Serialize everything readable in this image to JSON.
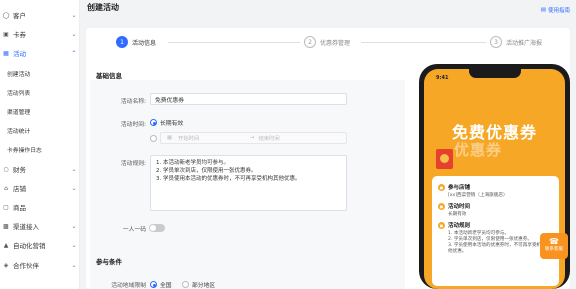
{
  "sidebar": {
    "items": [
      {
        "label": "客户",
        "icon": "user-icon"
      },
      {
        "label": "卡券",
        "icon": "ticket-icon"
      },
      {
        "label": "活动",
        "icon": "gift-icon"
      },
      {
        "label": "财务",
        "icon": "wallet-icon"
      },
      {
        "label": "店铺",
        "icon": "store-icon"
      },
      {
        "label": "商品",
        "icon": "box-icon"
      },
      {
        "label": "渠道接入",
        "icon": "plug-icon"
      },
      {
        "label": "自动化营销",
        "icon": "auto-icon"
      },
      {
        "label": "合作伙伴",
        "icon": "partner-icon"
      }
    ],
    "sub_items": [
      "创建活动",
      "活动列表",
      "渠道管理",
      "活动统计",
      "卡券操作日志"
    ]
  },
  "header": {
    "title": "创建活动",
    "help_label": "使用指南"
  },
  "steps": [
    {
      "num": "1",
      "label": "活动信息"
    },
    {
      "num": "2",
      "label": "优惠券管理"
    },
    {
      "num": "3",
      "label": "活动推广海报"
    }
  ],
  "form": {
    "section_basic": "基础信息",
    "name_label": "活动名称:",
    "name_value": "免费优惠券",
    "time_label": "活动时间:",
    "time_option_long": "长期有效",
    "start_placeholder": "开始时间",
    "end_placeholder": "结束时间",
    "rules_label": "活动规则:",
    "rules_lines": [
      "1. 本活动新老学员均可参与。",
      "2. 学员单次到店，仅限使用一张优惠券。",
      "3. 学员使用本活动的优惠券时，不可再享受机构其他优惠。"
    ],
    "one_person_label": "一人一码",
    "section_participation": "参与条件",
    "region_label": "活动地域限制",
    "region_all": "全国",
    "region_partial": "部分地区"
  },
  "phone": {
    "time": "9:41",
    "banner_title": "免费优惠券",
    "banner_sub": "优惠券",
    "store_title": "参与店铺",
    "store_text": "[xx]西菜营销（上海旗舰店）",
    "time_title": "活动时间",
    "time_text": "长期有效",
    "rules_title": "活动规则",
    "rules_text": [
      "1. 本活动新老学员均可参与。",
      "2. 学员单次到店，仅限使用一张优惠券。",
      "3. 学员使用本活动的优惠券时，不可再享受机构其他优惠。"
    ]
  },
  "float_button": {
    "label": "联系客服"
  },
  "colors": {
    "primary": "#2f6bff",
    "banner": "#f7a726"
  }
}
